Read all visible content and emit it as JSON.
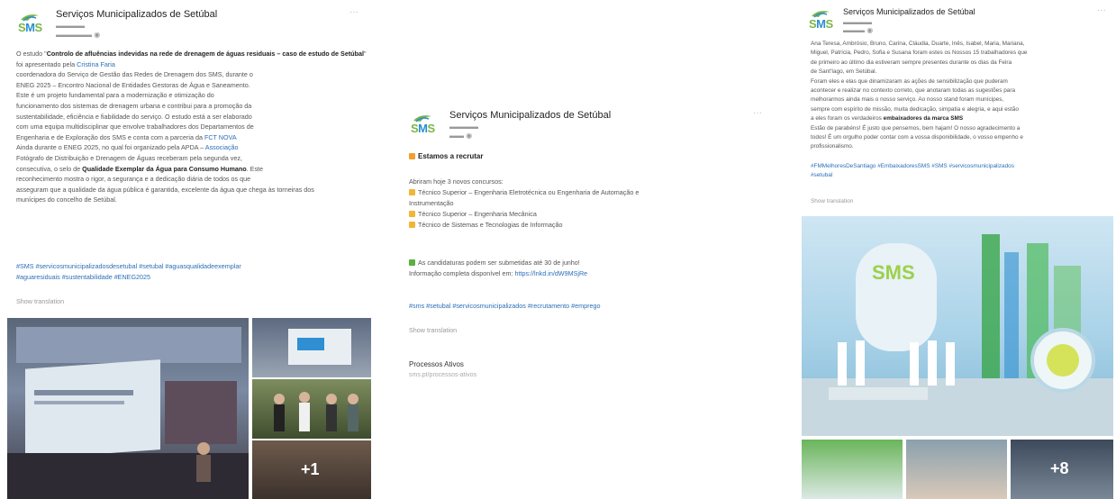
{
  "post1": {
    "org_name": "Serviços Municipalizados de Setúbal",
    "intro_a": "O estudo \"",
    "study_title": "Controlo de afluências indevidas na rede de drenagem de águas residuais – caso de estudo de Setúbal",
    "intro_b": "\" foi apresentado pela",
    "presenter": "Cristina Faria",
    "body_lines": [
      "coordenadora do Serviço de Gestão das Redes de Drenagem dos SMS, durante o",
      "ENEG 2025 – Encontro Nacional de Entidades Gestoras de Água e Saneamento.",
      "Este é um projeto fundamental para a modernização e otimização do",
      "funcionamento dos sistemas de drenagem urbana e contribui para a promoção da",
      "sustentabilidade, eficiência e fiabilidade do serviço. O estudo está a ser elaborado",
      "com uma equipa multidisciplinar que envolve trabalhadores dos Departamentos de",
      "Engenharia e de Exploração dos SMS e conta com a parceria da",
      "Ainda durante o ENEG 2025, no qual foi organizado pela APDA –",
      "Fotógrafo de Distribuição e Drenagem de Águas receberam pela segunda vez,",
      "consecutiva, o selo de",
      "reconhecimento mostra o rigor, a segurança e a dedicação diária de todos os que",
      "asseguram que a qualidade da água pública é garantida, excelente da água que chega às torneiras dos",
      "munícipes do concelho de Setúbal."
    ],
    "partner": "FCT NOVA",
    "apda_label": "Associação",
    "quality_seal": "Qualidade Exemplar da Água para Consumo Humano",
    "quality_tail": ". Este",
    "hashtags_1": "#SMS #servicosmunicipalizadosdesetubal #setubal #aguasqualidadeexemplar",
    "hashtags_2": "#aguaresiduais #sustentabilidade #ENEG2025",
    "show_translation": "Show translation",
    "more_photos": "+1"
  },
  "post2": {
    "org_name": "Serviços Municipalizados de Setúbal",
    "heading": "Estamos a recrutar",
    "open_label": "Abriram hoje 3 novos concursos:",
    "jobs": [
      "Técnico Superior – Engenharia Eletrotécnica ou Engenharia de Automação e",
      "Técnico Superior – Engenharia Mecânica",
      "Técnico de Sistemas e Tecnologias de Informação"
    ],
    "job1_cont": "Instrumentação",
    "deadline": "As candidaturas podem ser submetidas até 30 de junho!",
    "info_prefix": "Informação completa disponível em:",
    "info_link": "https://lnkd.in/dW9MSjRe",
    "hashtags": "#sms #setubal #servicosmunicipalizados #recrutamento #emprego",
    "show_translation": "Show translation",
    "card_title": "Processos Ativos",
    "card_sub": "sms.pt/processos-ativos"
  },
  "post3": {
    "org_name": "Serviços Municipalizados de Setúbal",
    "body_lines": [
      "Ana Teresa, Ambrósio, Bruno, Carina, Cláudia, Duarte, Inês, Isabel, Maria, Mariana,",
      "Miguel, Patrícia, Pedro, Sofia e Susana foram estes os Nossos 15 trabalhadores que",
      "de primeiro ao último dia estiveram sempre presentes durante os dias da Feira",
      "de Sant'Iago, em Setúbal.",
      "Foram eles e elas que dinamizaram as ações de sensibilização que puderam",
      "acontecer e realizar no contexto correto, que anotaram todas as sugestões para",
      "melhorarmos ainda mais o nosso serviço. Ao nosso stand foram munícipes,",
      "sempre com espírito de missão, muita dedicação, simpatia e alegria, e aqui estão",
      "a eles foram os verdadeiros",
      "Estão de parabéns! É justo que pensemos, bem hajam! O nosso agradecimento a",
      "todos! É um orgulho poder contar com a vossa disponibilidade, o vosso empenho e",
      "profissionalismo."
    ],
    "ambassadors": "embaixadores da marca SMS",
    "hashtags_1": "#FMMelhoresDeSantiago #EmbaixadoresSMS #SMS #servicosmunicipalizados",
    "hashtags_2": "#setubal",
    "show_translation": "Show translation",
    "more_photos": "+8"
  }
}
